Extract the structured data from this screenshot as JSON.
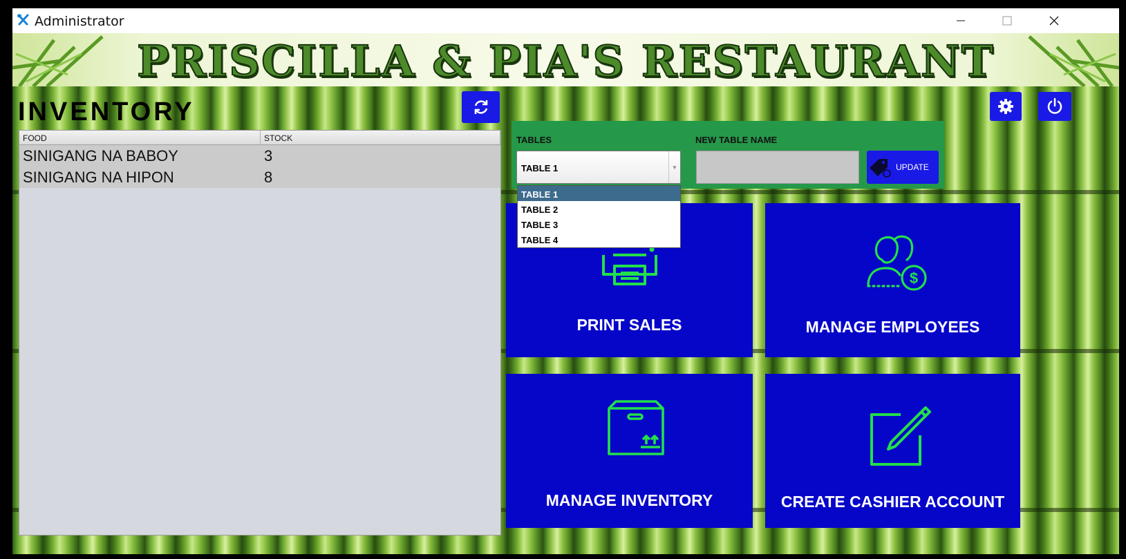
{
  "window": {
    "title": "Administrator",
    "controls": [
      "minimize",
      "maximize",
      "close"
    ]
  },
  "banner": {
    "title": "PRISCILLA & PIA'S RESTAURANT"
  },
  "inventory": {
    "heading": "INVENTORY",
    "columns": [
      "FOOD",
      "STOCK"
    ],
    "rows": [
      {
        "food": "SINIGANG NA BABOY",
        "stock": "3"
      },
      {
        "food": "SINIGANG NA HIPON",
        "stock": "8"
      }
    ]
  },
  "tables_panel": {
    "tables_label": "TABLES",
    "selected_table": "TABLE 1",
    "new_name_label": "NEW TABLE NAME",
    "new_name_value": "",
    "update_label": "UPDATE",
    "options": [
      "TABLE 1",
      "TABLE 2",
      "TABLE 3",
      "TABLE 4"
    ]
  },
  "tiles": {
    "print_sales": "PRINT SALES",
    "manage_employees": "MANAGE EMPLOYEES",
    "manage_inventory": "MANAGE INVENTORY",
    "create_cashier": "CREATE CASHIER ACCOUNT"
  },
  "colors": {
    "button_blue": "#1a1ae6",
    "tile_blue": "#0606c9",
    "icon_green": "#22e04a",
    "panel_green": "#26984a",
    "selected_option": "#3d6b8e"
  },
  "icons": {
    "app": "fork-spoon-icon",
    "refresh": "refresh-icon",
    "settings": "gear-icon",
    "power": "power-icon",
    "update": "price-tag-icon",
    "print": "printer-icon",
    "employees": "employees-money-icon",
    "inventory": "box-icon",
    "cashier": "edit-pencil-icon"
  }
}
